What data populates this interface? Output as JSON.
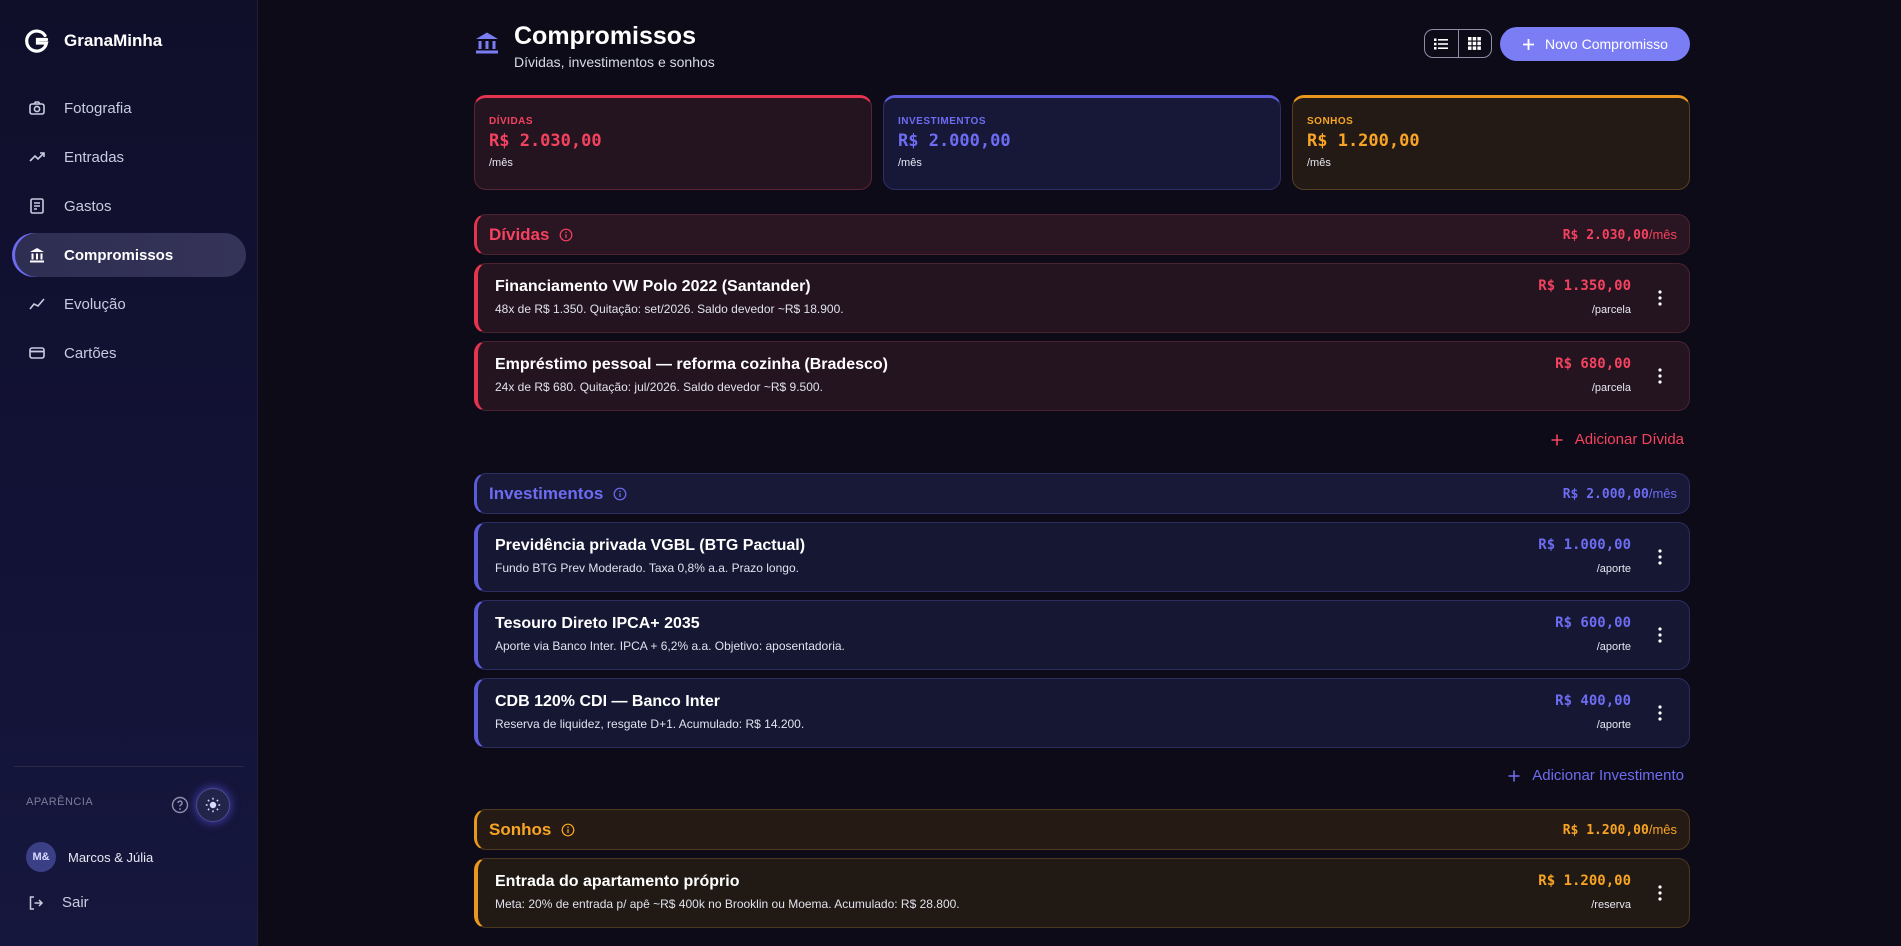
{
  "app": {
    "name": "GranaMinha"
  },
  "sidebar": {
    "items": [
      {
        "label": "Fotografia",
        "icon": "camera-icon"
      },
      {
        "label": "Entradas",
        "icon": "trending-up-icon"
      },
      {
        "label": "Gastos",
        "icon": "receipt-icon"
      },
      {
        "label": "Compromissos",
        "icon": "bank-icon",
        "active": true
      },
      {
        "label": "Evolução",
        "icon": "chart-line-icon"
      },
      {
        "label": "Cartões",
        "icon": "credit-card-icon"
      }
    ],
    "appearance_label": "APARÊNCIA",
    "user": {
      "initials": "M&",
      "name": "Marcos & Júlia"
    },
    "logout_label": "Sair"
  },
  "header": {
    "title": "Compromissos",
    "subtitle": "Dívidas, investimentos e sonhos",
    "new_button_label": "Novo Compromisso"
  },
  "summary": {
    "debts": {
      "label": "DÍVIDAS",
      "value": "R$ 2.030,00",
      "period": "/mês"
    },
    "investments": {
      "label": "INVESTIMENTOS",
      "value": "R$ 2.000,00",
      "period": "/mês"
    },
    "dreams": {
      "label": "SONHOS",
      "value": "R$ 1.200,00",
      "period": "/mês"
    }
  },
  "sections": {
    "debts": {
      "name": "Dívidas",
      "total": "R$ 2.030,00",
      "total_period": "/mês",
      "add_label": "Adicionar Dívida",
      "items": [
        {
          "title": "Financiamento VW Polo 2022 (Santander)",
          "description": "48x de R$ 1.350. Quitação: set/2026. Saldo devedor ~R$ 18.900.",
          "amount": "R$ 1.350,00",
          "unit": "/parcela"
        },
        {
          "title": "Empréstimo pessoal — reforma cozinha (Bradesco)",
          "description": "24x de R$ 680. Quitação: jul/2026. Saldo devedor ~R$ 9.500.",
          "amount": "R$ 680,00",
          "unit": "/parcela"
        }
      ]
    },
    "investments": {
      "name": "Investimentos",
      "total": "R$ 2.000,00",
      "total_period": "/mês",
      "add_label": "Adicionar Investimento",
      "items": [
        {
          "title": "Previdência privada VGBL (BTG Pactual)",
          "description": "Fundo BTG Prev Moderado. Taxa 0,8% a.a. Prazo longo.",
          "amount": "R$ 1.000,00",
          "unit": "/aporte"
        },
        {
          "title": "Tesouro Direto IPCA+ 2035",
          "description": "Aporte via Banco Inter. IPCA + 6,2% a.a. Objetivo: aposentadoria.",
          "amount": "R$ 600,00",
          "unit": "/aporte"
        },
        {
          "title": "CDB 120% CDI — Banco Inter",
          "description": "Reserva de liquidez, resgate D+1. Acumulado: R$ 14.200.",
          "amount": "R$ 400,00",
          "unit": "/aporte"
        }
      ]
    },
    "dreams": {
      "name": "Sonhos",
      "total": "R$ 1.200,00",
      "total_period": "/mês",
      "items": [
        {
          "title": "Entrada do apartamento próprio",
          "description": "Meta: 20% de entrada p/ apê ~R$ 400k no Brooklin ou Moema. Acumulado: R$ 28.800.",
          "amount": "R$ 1.200,00",
          "unit": "/reserva"
        }
      ]
    }
  },
  "colors": {
    "debt": "#f4425f",
    "investment": "#6d6cf2",
    "dream": "#f8a425",
    "accent": "#7b7df5"
  }
}
